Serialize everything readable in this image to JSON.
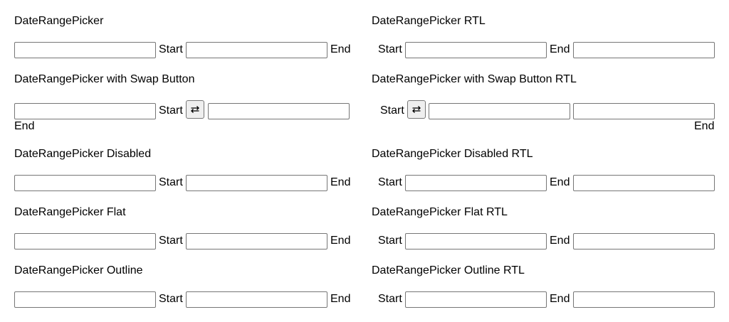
{
  "labels": {
    "start": "Start",
    "end": "End"
  },
  "sections": {
    "basic": {
      "title": "DateRangePicker"
    },
    "basic_rtl": {
      "title": "DateRangePicker RTL"
    },
    "swap": {
      "title": "DateRangePicker with Swap Button",
      "swap_icon": "swap-arrows-icon"
    },
    "swap_rtl": {
      "title": "DateRangePicker with Swap Button RTL",
      "swap_icon": "swap-arrows-icon"
    },
    "disabled": {
      "title": "DateRangePicker Disabled"
    },
    "disabled_rtl": {
      "title": "DateRangePicker Disabled RTL"
    },
    "flat": {
      "title": "DateRangePicker Flat"
    },
    "flat_rtl": {
      "title": "DateRangePicker Flat RTL"
    },
    "outline": {
      "title": "DateRangePicker Outline"
    },
    "outline_rtl": {
      "title": "DateRangePicker Outline RTL"
    }
  }
}
